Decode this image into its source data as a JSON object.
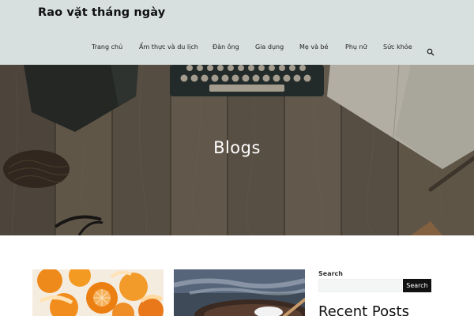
{
  "site": {
    "title": "Rao vặt tháng ngày"
  },
  "nav": {
    "items": [
      {
        "label": "Trang chủ"
      },
      {
        "label": "Ẩm thực và du lịch"
      },
      {
        "label": "Đàn ông"
      },
      {
        "label": "Gia dụng"
      },
      {
        "label": "Mẹ và bé"
      },
      {
        "label": "Phụ nữ"
      },
      {
        "label": "Sức khỏe"
      }
    ],
    "search_icon": "search-icon"
  },
  "hero": {
    "title": "Blogs"
  },
  "posts": [
    {
      "image": "oranges-photo"
    },
    {
      "image": "bowl-of-food-photo"
    }
  ],
  "sidebar": {
    "search_label": "Search",
    "search_placeholder": "",
    "search_button": "Search",
    "recent_heading": "Recent Posts"
  },
  "colors": {
    "header_bg": "#d7dfdf",
    "hero_wood": "#6d6254",
    "button_bg": "#111111"
  }
}
